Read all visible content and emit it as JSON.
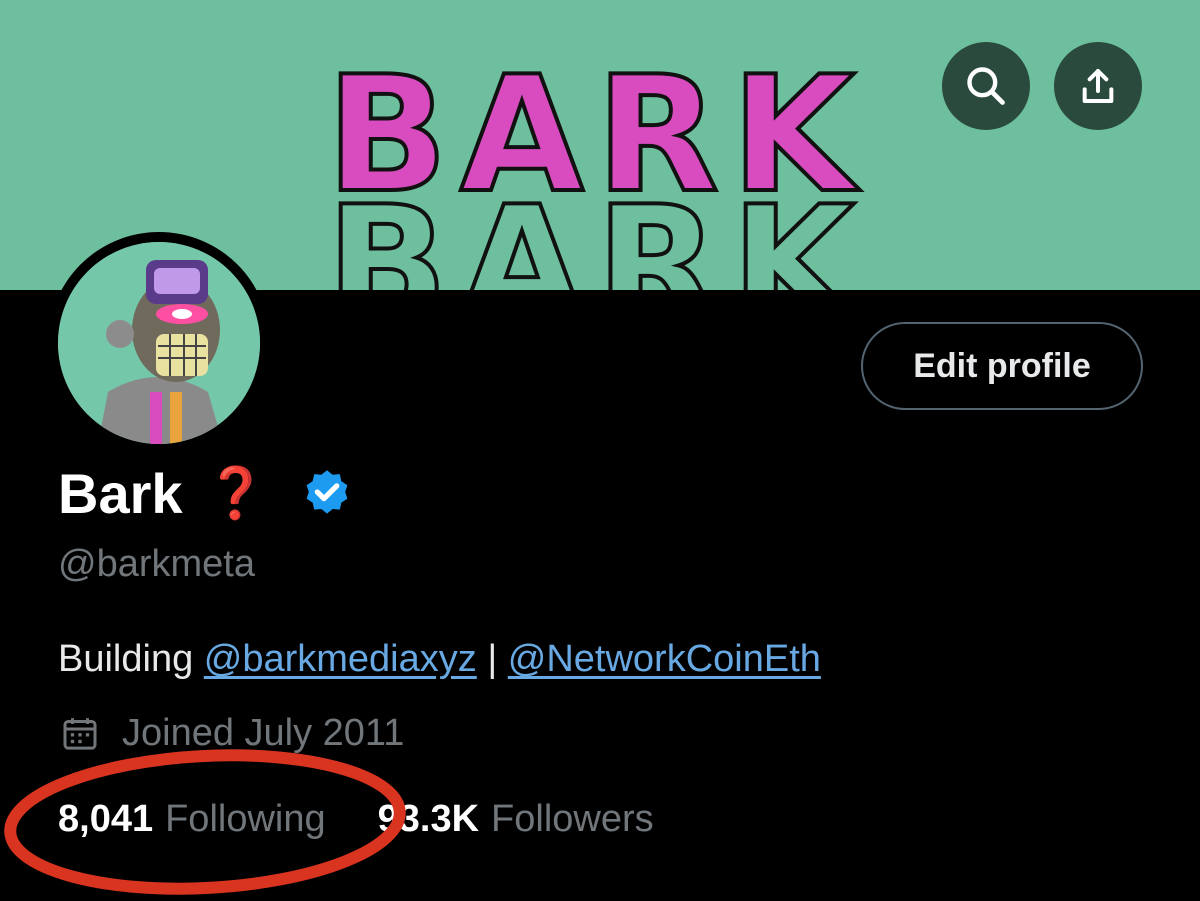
{
  "banner": {
    "art_text": "BARK",
    "art_text_echo": "BARK"
  },
  "toolbar": {
    "search_icon": "search-icon",
    "share_icon": "share-icon"
  },
  "profile": {
    "name": "Bark",
    "name_emoji": "❓",
    "handle": "@barkmeta",
    "bio_prefix": "Building ",
    "bio_link1": "@barkmediaxyz",
    "bio_separator": " | ",
    "bio_link2": "@NetworkCoinEth",
    "joined": "Joined July 2011"
  },
  "actions": {
    "edit_profile": "Edit profile"
  },
  "stats": {
    "following_count": "8,041",
    "following_label": "Following",
    "followers_count": "93.3K",
    "followers_label": "Followers"
  },
  "colors": {
    "banner": "#6dbf9e",
    "accent_pink": "#d94cbf",
    "link": "#68a9e3",
    "verified": "#1d9bf0",
    "annotation_red": "#d9341f"
  }
}
